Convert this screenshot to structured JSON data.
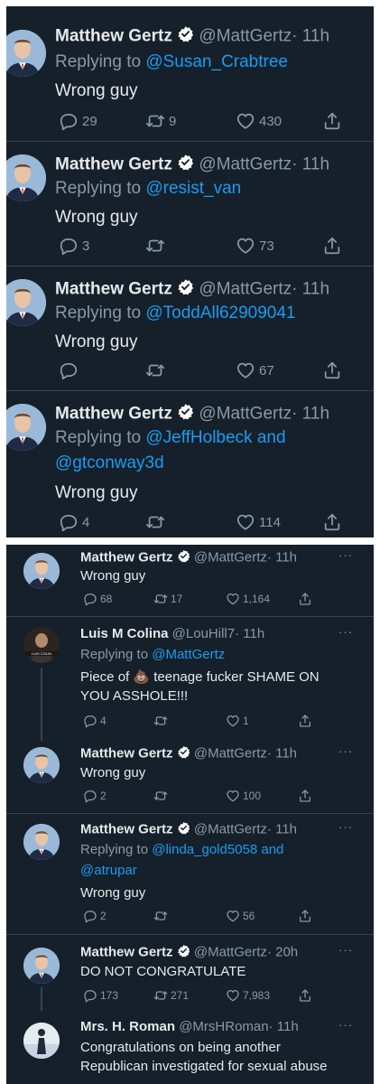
{
  "panel_top": {
    "tweets": [
      {
        "name": "Matthew Gertz",
        "handle": "@MattGertz",
        "time": "· 11h",
        "replying_prefix": "Replying to ",
        "replying_to": "@Susan_Crabtree",
        "replying_to_2": "",
        "text": "Wrong guy",
        "replies": "29",
        "retweets": "9",
        "likes": "430"
      },
      {
        "name": "Matthew Gertz",
        "handle": "@MattGertz",
        "time": "· 11h",
        "replying_prefix": "Replying to ",
        "replying_to": "@resist_van",
        "replying_to_2": "",
        "text": "Wrong guy",
        "replies": "3",
        "retweets": "",
        "likes": "73"
      },
      {
        "name": "Matthew Gertz",
        "handle": "@MattGertz",
        "time": "· 11h",
        "replying_prefix": "Replying to ",
        "replying_to": "@ToddAll62909041",
        "replying_to_2": "",
        "text": "Wrong guy",
        "replies": "",
        "retweets": "",
        "likes": "67"
      },
      {
        "name": "Matthew Gertz",
        "handle": "@MattGertz",
        "time": "· 11h",
        "replying_prefix": "Replying to ",
        "replying_to": "@JeffHolbeck and",
        "replying_to_2": "@gtconway3d",
        "text": "Wrong guy",
        "replies": "4",
        "retweets": "",
        "likes": "114"
      }
    ]
  },
  "panel_bottom": {
    "more_glyph": "···",
    "tweets": [
      {
        "name": "Matthew Gertz",
        "handle": "@MattGertz",
        "time": "· 11h",
        "text": "Wrong guy",
        "replies": "68",
        "retweets": "17",
        "likes": "1,164"
      },
      {
        "name": "Luis M Colina",
        "handle": "@LouHill7",
        "time": "· 11h",
        "replying_prefix": "Replying to ",
        "replying_to": "@MattGertz",
        "text_a": "Piece of",
        "emoji": "💩",
        "text_b": " teenage fucker SHAME ON",
        "text_c": "YOU ASSHOLE!!!",
        "replies": "4",
        "retweets": "",
        "likes": "1",
        "avatar_caption": "LUIS COLIN"
      },
      {
        "name": "Matthew Gertz",
        "handle": "@MattGertz",
        "time": "· 11h",
        "text": "Wrong guy",
        "replies": "2",
        "retweets": "",
        "likes": "100"
      },
      {
        "name": "Matthew Gertz",
        "handle": "@MattGertz",
        "time": "· 11h",
        "replying_prefix": "Replying to ",
        "replying_to": "@linda_gold5058 and",
        "replying_to_2": "@atrupar",
        "text": "Wrong guy",
        "replies": "2",
        "retweets": "",
        "likes": "56"
      },
      {
        "name": "Matthew Gertz",
        "handle": "@MattGertz",
        "time": "· 20h",
        "text": "DO NOT CONGRATULATE",
        "replies": "173",
        "retweets": "271",
        "likes": "7,983"
      },
      {
        "name": "Mrs. H. Roman",
        "handle": "@MrsHRoman",
        "time": "· 11h",
        "text_1": "Congratulations on being another",
        "text_2": "Republican investigated for sexual abuse"
      }
    ]
  },
  "icons": {
    "reply": "reply-icon",
    "retweet": "retweet-icon",
    "like": "heart-icon",
    "share": "share-icon",
    "verified": "verified-badge-icon",
    "more": "more-options-icon"
  },
  "colors": {
    "background": "#15202b",
    "text": "#e7e9ea",
    "muted": "#8b98a5",
    "link": "#1d9bf0",
    "divider": "#38444d"
  }
}
